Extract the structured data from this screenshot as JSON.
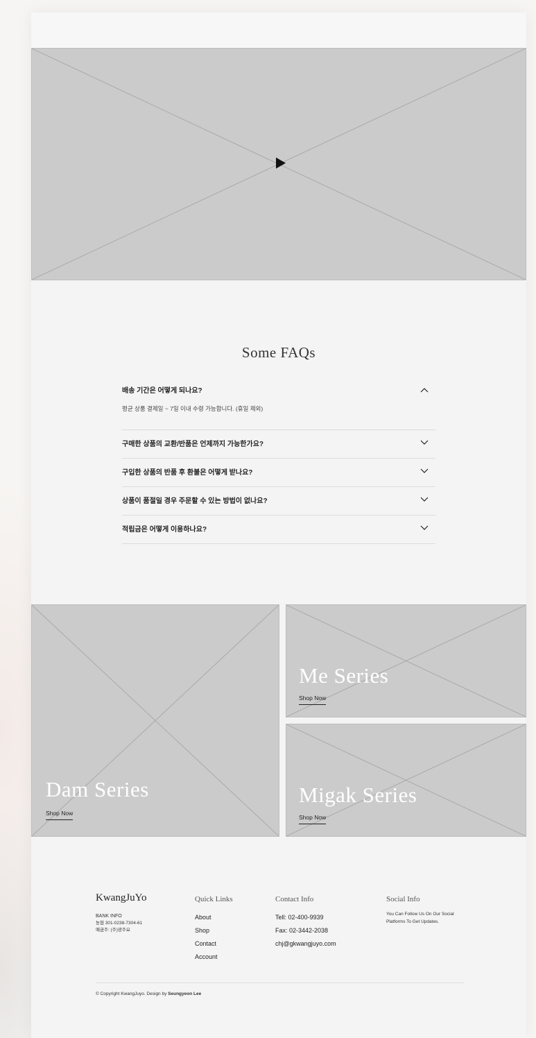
{
  "video": {
    "play_icon": "play-icon"
  },
  "faq": {
    "title": "Some FAQs",
    "items": [
      {
        "question": "배송 기간은 어떻게 되나요?",
        "answer": "평균 상품 결제일 ~ 7일 이내 수령 가능합니다. (휴일 제외)",
        "expanded": true
      },
      {
        "question": "구매한 상품의 교환/반품은 언제까지 가능한가요?",
        "expanded": false
      },
      {
        "question": "구입한 상품의 반품 후 환불은 어떻게 받나요?",
        "expanded": false
      },
      {
        "question": "상품이 품절일 경우 주문할 수 있는 방법이 없나요?",
        "expanded": false
      },
      {
        "question": "적립금은 어떻게 이용하나요?",
        "expanded": false
      }
    ],
    "chevron_up": "^",
    "chevron_down": "v"
  },
  "series": [
    {
      "name": "Dam Series",
      "link": "Shop Now"
    },
    {
      "name": "Me Series",
      "link": "Shop Now"
    },
    {
      "name": "Migak Series",
      "link": "Shop Now"
    }
  ],
  "footer": {
    "logo": "KwangJuYo",
    "bank_title": "BANK INFO",
    "bank_account": "농협 301-0238-7304-61",
    "bank_holder": "예금주: (주)광주요",
    "quick_links_title": "Quick Links",
    "quick_links": [
      "About",
      "Shop",
      "Contact",
      "Account"
    ],
    "contact_title": "Contact Info",
    "contact": [
      "Tell: 02-400-9939",
      "Fax: 02-3442-2038",
      "chj@gkwangjuyo.com"
    ],
    "social_title": "Social Info",
    "social_text": "You Can Follow Us On Our Social Platforms To Get Updates.",
    "copyright_prefix": "© Copyright KwangJuyo. Design by ",
    "copyright_author": "Seungyeon Lee"
  }
}
